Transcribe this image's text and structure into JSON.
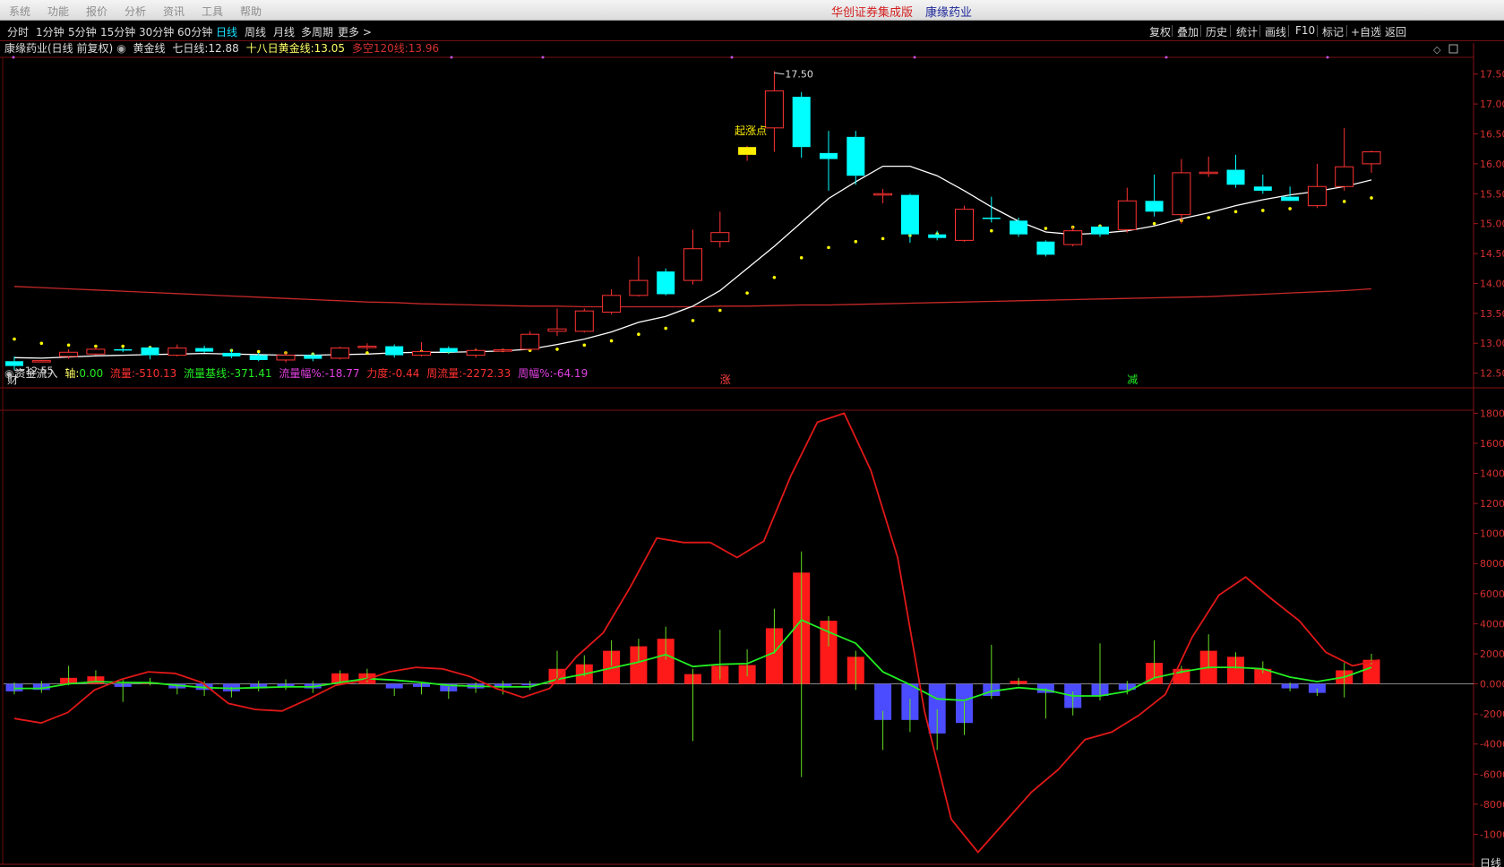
{
  "menu": {
    "items": [
      "系统",
      "功能",
      "报价",
      "分析",
      "资讯",
      "工具",
      "帮助"
    ],
    "brand": "华创证券集成版",
    "stock_name": "康缘药业"
  },
  "toolbar": {
    "periods": [
      "分时",
      "1分钟",
      "5分钟",
      "15分钟",
      "30分钟",
      "60分钟",
      "日线",
      "周线",
      "月线",
      "多周期",
      "更多 >"
    ],
    "active_period": "日线",
    "right_buttons": [
      "复权",
      "叠加",
      "历史",
      "统计",
      "画线",
      "F10",
      "标记",
      "+自选",
      "返回"
    ]
  },
  "main_chart": {
    "title": "康缘药业(日线 前复权)",
    "indicator_name": "黄金线",
    "legend": {
      "ma7_label": "七日线:",
      "ma7_value": "12.88",
      "ma18_label": "十八日黄金线:",
      "ma18_value": "13.05",
      "ma120_label": "多空120线:",
      "ma120_value": "13.96"
    },
    "price_ticks": [
      "17.50",
      "17.00",
      "16.50",
      "16.00",
      "15.50",
      "15.00",
      "14.50",
      "14.00",
      "13.50",
      "13.00",
      "12.50"
    ],
    "annotations": {
      "high_label": "17.50",
      "low_label": "12.55",
      "rise_point_label": "起涨点",
      "marker_cai": "财",
      "marker_zhang": "涨",
      "marker_jian": "减"
    },
    "colors": {
      "up": "#ff3333",
      "down": "#00ffff",
      "ma7": "#ffffff",
      "ma120": "#c62828",
      "dots": "#ffff00"
    },
    "ylim": [
      12.3,
      17.75
    ]
  },
  "sub_chart": {
    "title": "资金流入",
    "legend": {
      "axis_label": "轴:",
      "axis_value": "0.00",
      "flow_label": "流量:",
      "flow_value": "-510.13",
      "base_label": "流量基线:",
      "base_value": "-371.41",
      "amp_label": "流量幅%:",
      "amp_value": "-18.77",
      "force_label": "力度:",
      "force_value": "-0.44",
      "week_flow_label": "周流量:",
      "week_flow_value": "-2272.33",
      "week_amp_label": "周幅%:",
      "week_amp_value": "-64.19"
    },
    "ticks": [
      "18000",
      "16000",
      "14000",
      "12000",
      "10000",
      "8000",
      "6000",
      "4000",
      "2000",
      "0.000",
      "-2000",
      "-4000",
      "-6000",
      "-8000",
      "-10000"
    ],
    "ylim": [
      -12000,
      18200
    ],
    "colors": {
      "pos": "#ff1a1a",
      "neg": "#4b4bff",
      "green": "#22ee22",
      "red_line": "#e01818"
    }
  },
  "status": {
    "right_label": "日线"
  },
  "chart_data": [
    {
      "type": "candlestick",
      "title": "康缘药业(日线 前复权)",
      "ylim": [
        12.3,
        17.75
      ],
      "candles": [
        {
          "o": 12.7,
          "h": 12.78,
          "l": 12.55,
          "c": 12.62
        },
        {
          "o": 12.7,
          "h": 12.72,
          "l": 12.68,
          "c": 12.71
        },
        {
          "o": 12.78,
          "h": 12.9,
          "l": 12.74,
          "c": 12.85
        },
        {
          "o": 12.82,
          "h": 12.94,
          "l": 12.8,
          "c": 12.9
        },
        {
          "o": 12.9,
          "h": 12.92,
          "l": 12.85,
          "c": 12.88
        },
        {
          "o": 12.93,
          "h": 12.95,
          "l": 12.73,
          "c": 12.8
        },
        {
          "o": 12.8,
          "h": 12.98,
          "l": 12.78,
          "c": 12.92
        },
        {
          "o": 12.92,
          "h": 12.96,
          "l": 12.84,
          "c": 12.86
        },
        {
          "o": 12.84,
          "h": 12.9,
          "l": 12.75,
          "c": 12.78
        },
        {
          "o": 12.8,
          "h": 12.84,
          "l": 12.7,
          "c": 12.72
        },
        {
          "o": 12.72,
          "h": 12.86,
          "l": 12.68,
          "c": 12.8
        },
        {
          "o": 12.8,
          "h": 12.84,
          "l": 12.7,
          "c": 12.74
        },
        {
          "o": 12.75,
          "h": 12.94,
          "l": 12.73,
          "c": 12.92
        },
        {
          "o": 12.94,
          "h": 13.0,
          "l": 12.88,
          "c": 12.95
        },
        {
          "o": 12.95,
          "h": 12.98,
          "l": 12.76,
          "c": 12.8
        },
        {
          "o": 12.8,
          "h": 13.02,
          "l": 12.78,
          "c": 12.86
        },
        {
          "o": 12.92,
          "h": 12.95,
          "l": 12.82,
          "c": 12.85
        },
        {
          "o": 12.8,
          "h": 12.92,
          "l": 12.76,
          "c": 12.88
        },
        {
          "o": 12.88,
          "h": 12.91,
          "l": 12.85,
          "c": 12.89
        },
        {
          "o": 12.9,
          "h": 13.2,
          "l": 12.88,
          "c": 13.15
        },
        {
          "o": 13.2,
          "h": 13.58,
          "l": 13.12,
          "c": 13.24
        },
        {
          "o": 13.2,
          "h": 13.58,
          "l": 13.18,
          "c": 13.54
        },
        {
          "o": 13.52,
          "h": 13.9,
          "l": 13.48,
          "c": 13.8
        },
        {
          "o": 13.8,
          "h": 14.45,
          "l": 13.78,
          "c": 14.05
        },
        {
          "o": 14.2,
          "h": 14.25,
          "l": 13.8,
          "c": 13.82
        },
        {
          "o": 14.05,
          "h": 14.9,
          "l": 13.98,
          "c": 14.58
        },
        {
          "o": 14.7,
          "h": 15.2,
          "l": 14.6,
          "c": 14.85
        },
        {
          "o": 16.15,
          "h": 16.3,
          "l": 16.05,
          "c": 16.28
        },
        {
          "o": 16.6,
          "h": 17.55,
          "l": 16.2,
          "c": 17.22
        },
        {
          "o": 17.12,
          "h": 17.2,
          "l": 16.1,
          "c": 16.28
        },
        {
          "o": 16.18,
          "h": 16.55,
          "l": 15.55,
          "c": 16.08
        },
        {
          "o": 16.45,
          "h": 16.55,
          "l": 15.65,
          "c": 15.8
        },
        {
          "o": 15.5,
          "h": 15.58,
          "l": 15.34,
          "c": 15.5
        },
        {
          "o": 15.48,
          "h": 15.5,
          "l": 14.68,
          "c": 14.82
        },
        {
          "o": 14.82,
          "h": 14.88,
          "l": 14.72,
          "c": 14.76
        },
        {
          "o": 14.72,
          "h": 15.3,
          "l": 14.7,
          "c": 15.24
        },
        {
          "o": 15.1,
          "h": 15.45,
          "l": 15.02,
          "c": 15.08
        },
        {
          "o": 15.05,
          "h": 15.1,
          "l": 14.78,
          "c": 14.82
        },
        {
          "o": 14.7,
          "h": 14.72,
          "l": 14.45,
          "c": 14.48
        },
        {
          "o": 14.65,
          "h": 14.95,
          "l": 14.62,
          "c": 14.88
        },
        {
          "o": 14.95,
          "h": 14.98,
          "l": 14.78,
          "c": 14.82
        },
        {
          "o": 14.9,
          "h": 15.6,
          "l": 14.85,
          "c": 15.38
        },
        {
          "o": 15.38,
          "h": 15.82,
          "l": 15.12,
          "c": 15.2
        },
        {
          "o": 15.15,
          "h": 16.08,
          "l": 15.0,
          "c": 15.85
        },
        {
          "o": 15.85,
          "h": 16.12,
          "l": 15.78,
          "c": 15.86
        },
        {
          "o": 15.9,
          "h": 16.15,
          "l": 15.6,
          "c": 15.65
        },
        {
          "o": 15.62,
          "h": 15.82,
          "l": 15.5,
          "c": 15.55
        },
        {
          "o": 15.45,
          "h": 15.62,
          "l": 15.4,
          "c": 15.38
        },
        {
          "o": 15.3,
          "h": 16.0,
          "l": 15.26,
          "c": 15.62
        },
        {
          "o": 15.62,
          "h": 16.6,
          "l": 15.55,
          "c": 15.95
        },
        {
          "o": 16.0,
          "h": 16.22,
          "l": 15.85,
          "c": 16.2
        }
      ],
      "ma7": [
        12.76,
        12.75,
        12.77,
        12.79,
        12.8,
        12.81,
        12.82,
        12.83,
        12.82,
        12.81,
        12.8,
        12.8,
        12.81,
        12.82,
        12.84,
        12.85,
        12.85,
        12.86,
        12.87,
        12.9,
        12.98,
        13.07,
        13.19,
        13.35,
        13.45,
        13.62,
        13.88,
        14.25,
        14.62,
        15.02,
        15.42,
        15.7,
        15.96,
        15.96,
        15.8,
        15.55,
        15.28,
        15.04,
        14.86,
        14.82,
        14.84,
        14.88,
        14.96,
        15.08,
        15.18,
        15.3,
        15.4,
        15.48,
        15.54,
        15.62,
        15.73
      ],
      "ma120": [
        13.95,
        13.93,
        13.91,
        13.89,
        13.87,
        13.85,
        13.83,
        13.81,
        13.79,
        13.77,
        13.75,
        13.73,
        13.71,
        13.69,
        13.68,
        13.66,
        13.65,
        13.64,
        13.63,
        13.62,
        13.62,
        13.61,
        13.61,
        13.61,
        13.61,
        13.61,
        13.62,
        13.62,
        13.63,
        13.64,
        13.64,
        13.65,
        13.66,
        13.67,
        13.68,
        13.69,
        13.7,
        13.71,
        13.72,
        13.73,
        13.74,
        13.75,
        13.76,
        13.77,
        13.78,
        13.8,
        13.82,
        13.84,
        13.86,
        13.88,
        13.91
      ],
      "dots": [
        13.07,
        13.0,
        12.97,
        12.95,
        12.95,
        12.93,
        12.9,
        12.89,
        12.88,
        12.86,
        12.84,
        12.82,
        12.83,
        12.84,
        12.85,
        12.86,
        12.86,
        12.87,
        12.88,
        12.88,
        12.9,
        12.97,
        13.04,
        13.15,
        13.25,
        13.38,
        13.55,
        13.84,
        14.1,
        14.43,
        14.6,
        14.7,
        14.75,
        14.8,
        14.83,
        14.86,
        14.88,
        14.9,
        14.92,
        14.94,
        14.96,
        14.98,
        15.0,
        15.05,
        15.1,
        15.2,
        15.22,
        15.25,
        15.32,
        15.37,
        15.43
      ]
    },
    {
      "type": "bar",
      "title": "资金流入",
      "ylim": [
        -12000,
        18200
      ],
      "bars": [
        -500,
        -400,
        400,
        500,
        -200,
        100,
        -300,
        -400,
        -500,
        -300,
        -200,
        -300,
        700,
        700,
        -300,
        -200,
        -500,
        -300,
        -200,
        -100,
        1000,
        1300,
        2200,
        2500,
        3000,
        650,
        1200,
        1250,
        3700,
        7400,
        4200,
        1800,
        -2400,
        -2400,
        -3300,
        -2600,
        -800,
        200,
        -600,
        -1600,
        -800,
        -400,
        1400,
        1000,
        2200,
        1800,
        1000,
        -300,
        -600,
        900,
        1600
      ],
      "wicks": [
        [
          -700,
          100
        ],
        [
          -600,
          200
        ],
        [
          -100,
          1200
        ],
        [
          200,
          900
        ],
        [
          -1200,
          300
        ],
        [
          -100,
          400
        ],
        [
          -700,
          -100
        ],
        [
          -800,
          200
        ],
        [
          -900,
          -200
        ],
        [
          -500,
          200
        ],
        [
          -400,
          300
        ],
        [
          -600,
          200
        ],
        [
          -100,
          900
        ],
        [
          100,
          1000
        ],
        [
          -800,
          -300
        ],
        [
          -700,
          100
        ],
        [
          -1000,
          -200
        ],
        [
          -600,
          100
        ],
        [
          -700,
          200
        ],
        [
          -400,
          200
        ],
        [
          200,
          2200
        ],
        [
          500,
          1900
        ],
        [
          1200,
          2900
        ],
        [
          1500,
          3000
        ],
        [
          1600,
          3800
        ],
        [
          -3800,
          1000
        ],
        [
          300,
          3600
        ],
        [
          500,
          2300
        ],
        [
          2000,
          5000
        ],
        [
          -6200,
          8800
        ],
        [
          2500,
          4500
        ],
        [
          -400,
          2200
        ],
        [
          -4400,
          -1800
        ],
        [
          -3200,
          -1000
        ],
        [
          -4400,
          -1700
        ],
        [
          -3400,
          -1200
        ],
        [
          -1000,
          2600
        ],
        [
          -100,
          400
        ],
        [
          -2300,
          -300
        ],
        [
          -2100,
          -500
        ],
        [
          -1100,
          2700
        ],
        [
          -700,
          200
        ],
        [
          400,
          2900
        ],
        [
          700,
          1200
        ],
        [
          1000,
          3300
        ],
        [
          1000,
          2100
        ],
        [
          700,
          1500
        ],
        [
          -500,
          100
        ],
        [
          -800,
          -300
        ],
        [
          -900,
          1400
        ],
        [
          1300,
          2000
        ]
      ],
      "flow_baseline_green": [
        -300,
        -300,
        0,
        150,
        100,
        80,
        -100,
        -250,
        -300,
        -250,
        -200,
        -200,
        100,
        350,
        250,
        100,
        -100,
        -150,
        -200,
        -200,
        300,
        650,
        1050,
        1450,
        1950,
        1150,
        1300,
        1350,
        2100,
        4250,
        3450,
        2700,
        800,
        -50,
        -1000,
        -1100,
        -500,
        -250,
        -400,
        -800,
        -800,
        -500,
        400,
        800,
        1100,
        1100,
        1000,
        450,
        150,
        450,
        1100
      ],
      "week_flow_red": [
        -2300,
        -2600,
        -1900,
        -400,
        300,
        800,
        700,
        100,
        -1300,
        -1700,
        -1800,
        -1000,
        -100,
        200,
        800,
        1100,
        1000,
        500,
        -300,
        -900,
        -300,
        1800,
        3400,
        6400,
        9700,
        9400,
        9400,
        8400,
        9500,
        13800,
        17400,
        18000,
        14200,
        8400,
        -1800,
        -9000,
        -11200,
        -9200,
        -7200,
        -5700,
        -3700,
        -3200,
        -2100,
        -700,
        3100,
        5900,
        7100,
        5600,
        4200,
        2100,
        1200,
        1600
      ]
    }
  ]
}
